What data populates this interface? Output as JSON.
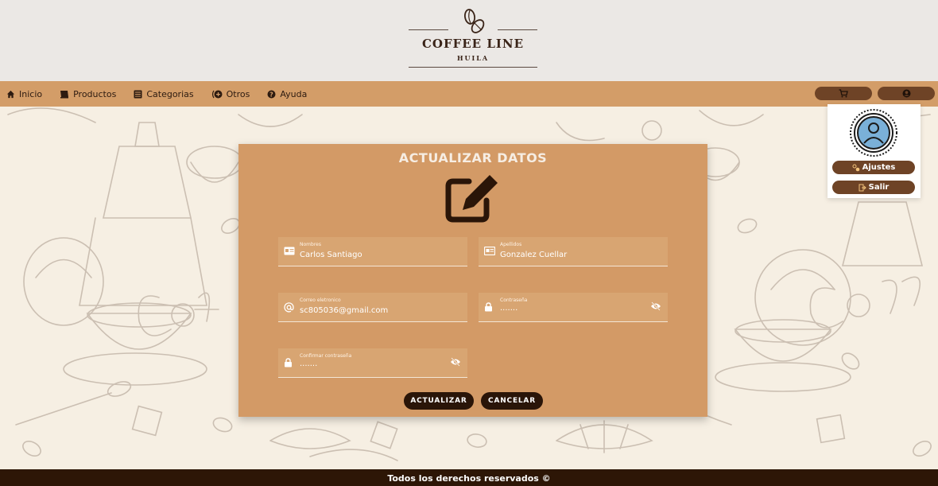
{
  "brand": {
    "title": "COFFEE LINE",
    "subtitle": "HUILA"
  },
  "nav": {
    "items": [
      {
        "label": "Inicio",
        "icon": "home-icon"
      },
      {
        "label": "Productos",
        "icon": "book-icon"
      },
      {
        "label": "Categorias",
        "icon": "list-icon"
      },
      {
        "label": "Otros",
        "icon": "plus-circle-icon"
      },
      {
        "label": "Ayuda",
        "icon": "help-icon"
      }
    ],
    "cart_icon": "cart-icon",
    "user_icon": "user-circle-icon"
  },
  "user_menu": {
    "settings_label": "Ajustes",
    "logout_label": "Salir"
  },
  "form": {
    "title": "ACTUALIZAR DATOS",
    "nombres": {
      "label": "Nombres",
      "value": "Carlos Santiago"
    },
    "apellidos": {
      "label": "Apellidos",
      "value": "Gonzalez Cuellar"
    },
    "correo": {
      "label": "Correo eletronico",
      "value": "sc805036@gmail.com"
    },
    "contrasena": {
      "label": "Contraseña",
      "value": "·······"
    },
    "confirmar": {
      "label": "Confirmar contraseña",
      "value": "·······"
    },
    "update_label": "ACTUALIZAR",
    "cancel_label": "CANCELAR"
  },
  "footer": {
    "text": "Todos los derechos reservados ©"
  },
  "colors": {
    "nav_bg": "#d39d68",
    "card_bg": "#d39a66",
    "button_dark": "#2a1508",
    "pill_brown": "#6e4326",
    "footer_bg": "#2d1606"
  }
}
